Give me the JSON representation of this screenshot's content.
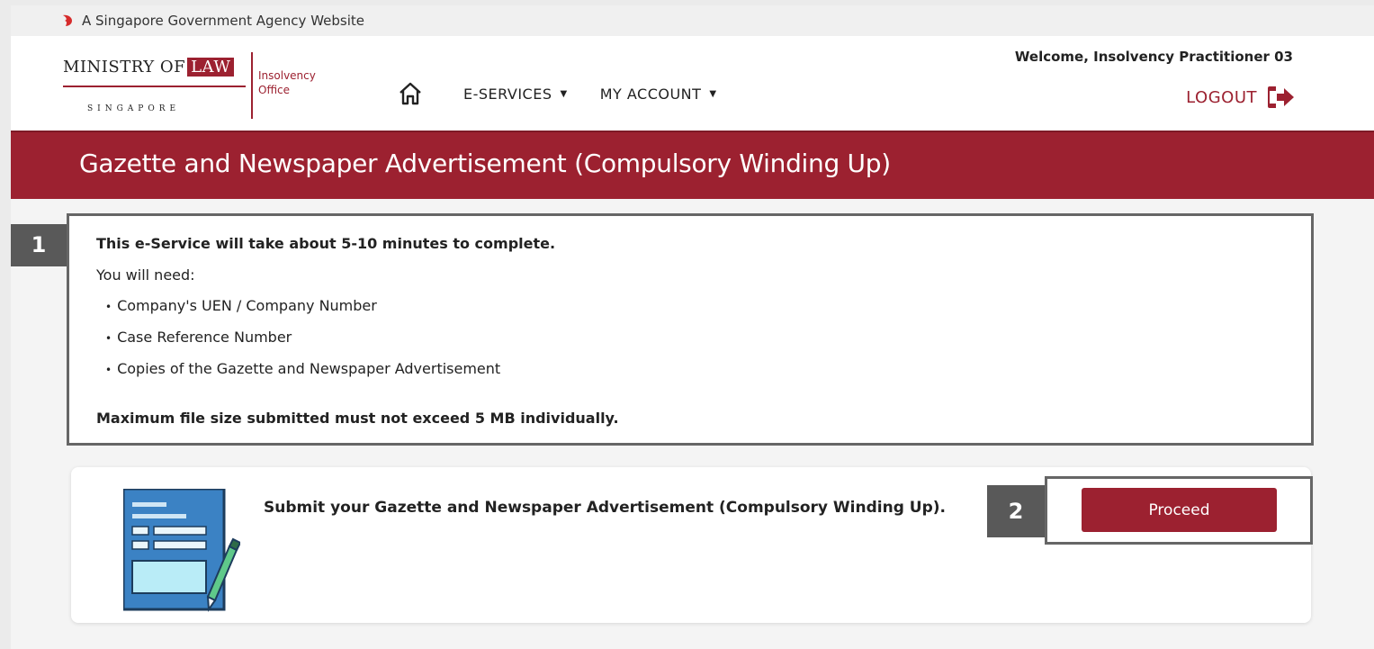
{
  "masthead": {
    "text": "A Singapore Government Agency Website",
    "icon": "lion-head-icon",
    "icon_color": "#d62b2b"
  },
  "header": {
    "logo": {
      "ministry_of": "MINISTRY OF",
      "law": "LAW",
      "singapore": "SINGAPORE",
      "office_line1": "Insolvency",
      "office_line2": "Office"
    },
    "nav": {
      "home_icon": "home-icon",
      "items": [
        {
          "label": "E-SERVICES"
        },
        {
          "label": "MY ACCOUNT"
        }
      ]
    },
    "welcome": "Welcome, Insolvency Practitioner 03",
    "logout_label": "LOGOUT",
    "logout_icon": "sign-out-icon"
  },
  "title_bar": {
    "title": "Gazette and Newspaper Advertisement (Compulsory Winding Up)"
  },
  "info": {
    "badge": "1",
    "title": "This e-Service will take about 5-10 minutes to complete.",
    "need_label": "You will need:",
    "items": [
      "Company's UEN / Company Number",
      "Case Reference Number",
      "Copies of the Gazette and Newspaper Advertisement"
    ],
    "max_note": "Maximum file size submitted must not exceed 5 MB individually."
  },
  "submit_card": {
    "illustration": "document-pen-icon",
    "text": "Submit your Gazette and Newspaper Advertisement (Compulsory Winding Up).",
    "badge": "2",
    "proceed_label": "Proceed"
  },
  "colors": {
    "brand": "#9c2130",
    "badge": "#595959",
    "page_bg": "#f4f4f4"
  }
}
